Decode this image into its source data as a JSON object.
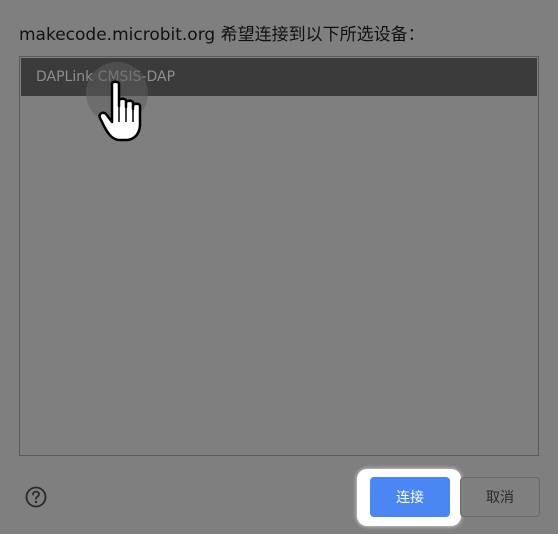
{
  "dialog": {
    "title": "makecode.microbit.org 希望连接到以下所选设备："
  },
  "device_list": {
    "items": [
      {
        "label": "DAPLink CMSIS-DAP",
        "selected": true
      }
    ]
  },
  "footer": {
    "help_icon": "question-circle-icon",
    "connect_label": "连接",
    "cancel_label": "取消"
  },
  "colors": {
    "overlay": "#7f7f7f",
    "selected_row": "#3b3b3b",
    "accent": "#4a87f2"
  }
}
